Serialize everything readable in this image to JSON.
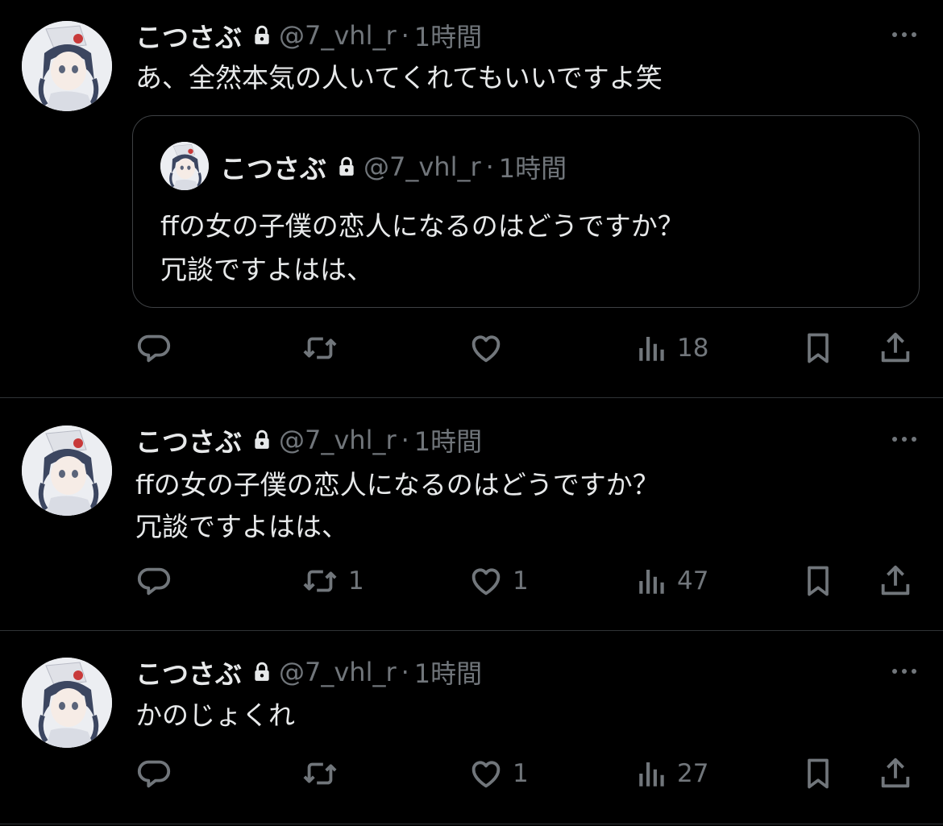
{
  "colors": {
    "background": "#000000",
    "text": "#e7e9ea",
    "secondary": "#71767b",
    "divider": "#2f3336"
  },
  "tweets": [
    {
      "name": "こつさぶ",
      "handle": "@7_vhl_r",
      "separator": "·",
      "time": "1時間",
      "text": "あ、全然本気の人いてくれてもいいですよ笑",
      "quote": {
        "name": "こつさぶ",
        "handle": "@7_vhl_r",
        "separator": "·",
        "time": "1時間",
        "text": "ffの女の子僕の恋人になるのはどうですか？\n冗談ですよはは、"
      },
      "replies": "",
      "retweets": "",
      "likes": "",
      "views": "18"
    },
    {
      "name": "こつさぶ",
      "handle": "@7_vhl_r",
      "separator": "·",
      "time": "1時間",
      "text": "ffの女の子僕の恋人になるのはどうですか？\n冗談ですよはは、",
      "replies": "",
      "retweets": "1",
      "likes": "1",
      "views": "47"
    },
    {
      "name": "こつさぶ",
      "handle": "@7_vhl_r",
      "separator": "·",
      "time": "1時間",
      "text": "かのじょくれ",
      "replies": "",
      "retweets": "",
      "likes": "1",
      "views": "27"
    }
  ],
  "icons": {
    "lock": "lock-icon",
    "more": "more-icon",
    "reply": "reply-icon",
    "retweet": "retweet-icon",
    "like": "heart-icon",
    "views": "views-icon",
    "bookmark": "bookmark-icon",
    "share": "share-icon"
  }
}
